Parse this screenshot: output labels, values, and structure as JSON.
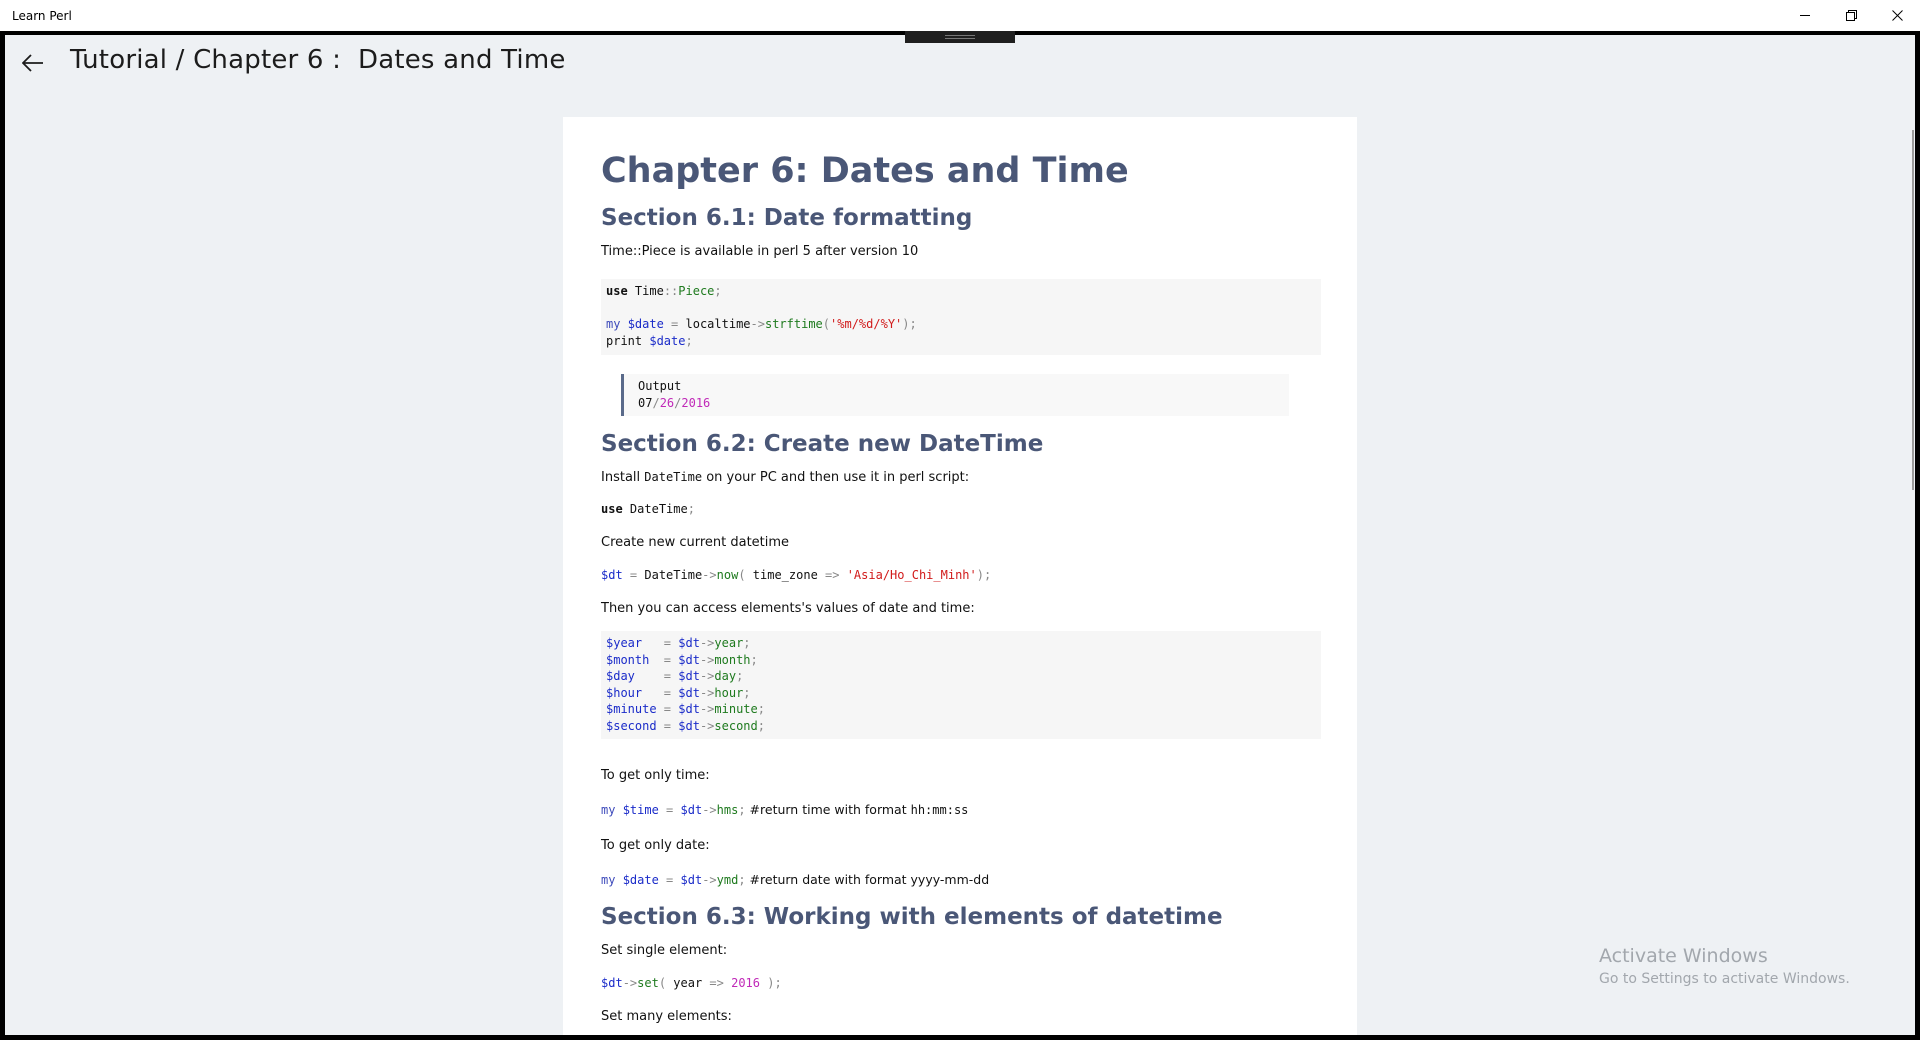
{
  "window": {
    "app_title": "Learn Perl",
    "controls": {
      "minimize": "minimize-icon",
      "maximize": "restore-icon",
      "close": "close-icon"
    }
  },
  "header": {
    "back_icon": "arrow-left-icon",
    "title": "Tutorial / Chapter 6 :  Dates and Time"
  },
  "doc": {
    "chapter_title": "Chapter 6: Dates and Time",
    "s61": {
      "title": "Section 6.1: Date formatting",
      "intro": "Time::Piece is available in perl 5 after version 10",
      "code": {
        "use_kw": "use",
        "use_mod": "Time",
        "use_sep": "::",
        "use_piece": "Piece",
        "use_semi": ";",
        "my": "my",
        "var": "$date",
        "eq": " = ",
        "func": "localtime",
        "arrow": "->",
        "method": "strftime",
        "open": "(",
        "fmt": "'%m/%d/%Y'",
        "close": ");",
        "print_kw": "print",
        "print_var": "$date",
        "print_semi": ";"
      },
      "output_label": "Output",
      "output_month": "07",
      "output_sep1": "/",
      "output_day": "26",
      "output_sep2": "/",
      "output_year": "2016"
    },
    "s62": {
      "title": "Section 6.2: Create new DateTime",
      "intro_pre": "Install ",
      "intro_code": "DateTime",
      "intro_post": " on your PC and then use it in perl script:",
      "use_kw": "use",
      "use_mod": "DateTime",
      "use_semi": ";",
      "create_text": "Create new current datetime",
      "now_line": {
        "var": "$dt",
        "eq": " = ",
        "cls": "DateTime",
        "arrow": "->",
        "method": "now",
        "open": "( ",
        "arg": "time_zone",
        "fat": " => ",
        "str": "'Asia/Ho_Chi_Minh'",
        "close": ");"
      },
      "access_text": "Then you can access elements's values of date and time:",
      "access_lines": [
        {
          "var": "$year",
          "pad": "   = ",
          "obj": "$dt",
          "arrow": "->",
          "method": "year",
          "semi": ";"
        },
        {
          "var": "$month",
          "pad": "  = ",
          "obj": "$dt",
          "arrow": "->",
          "method": "month",
          "semi": ";"
        },
        {
          "var": "$day",
          "pad": "    = ",
          "obj": "$dt",
          "arrow": "->",
          "method": "day",
          "semi": ";"
        },
        {
          "var": "$hour",
          "pad": "   = ",
          "obj": "$dt",
          "arrow": "->",
          "method": "hour",
          "semi": ";"
        },
        {
          "var": "$minute",
          "pad": " = ",
          "obj": "$dt",
          "arrow": "->",
          "method": "minute",
          "semi": ";"
        },
        {
          "var": "$second",
          "pad": " = ",
          "obj": "$dt",
          "arrow": "->",
          "method": "second",
          "semi": ";"
        }
      ],
      "time_text": "To get only time:",
      "time_line": {
        "my": "my",
        "var": "$time",
        "eq": " = ",
        "obj": "$dt",
        "arrow": "->",
        "method": "hms",
        "semi": ";",
        "comment_pre": " #return time with format ",
        "comment_code": "hh:mm:ss"
      },
      "date_text": "To get only date:",
      "date_line": {
        "my": "my",
        "var": "$date",
        "eq": " = ",
        "obj": "$dt",
        "arrow": "->",
        "method": "ymd",
        "semi": ";",
        "comment_pre": " #return date with format yyyy-mm-dd"
      }
    },
    "s63": {
      "title": "Section 6.3: Working with elements of datetime",
      "single_text": "Set single element:",
      "set_line": {
        "obj": "$dt",
        "arrow": "->",
        "method": "set",
        "open": "( ",
        "arg": "year",
        "fat": " => ",
        "num": "2016",
        "close": " );"
      },
      "many_text": "Set many elements:"
    }
  },
  "watermark": {
    "title": "Activate Windows",
    "subtitle": "Go to Settings to activate Windows."
  }
}
